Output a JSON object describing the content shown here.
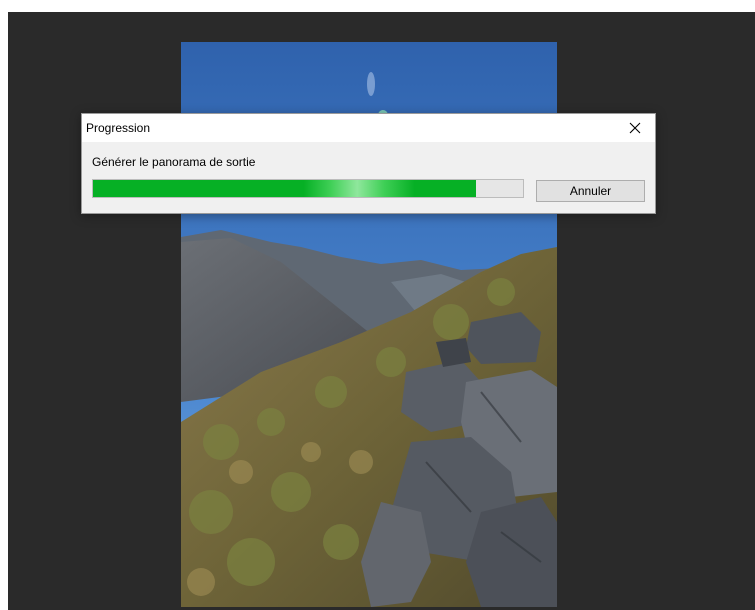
{
  "dialog": {
    "title": "Progression",
    "message": "Générer le panorama de sortie",
    "progress_percent": 89,
    "cancel_label": "Annuler",
    "close_icon": "close-icon",
    "accent_color": "#06b025"
  }
}
